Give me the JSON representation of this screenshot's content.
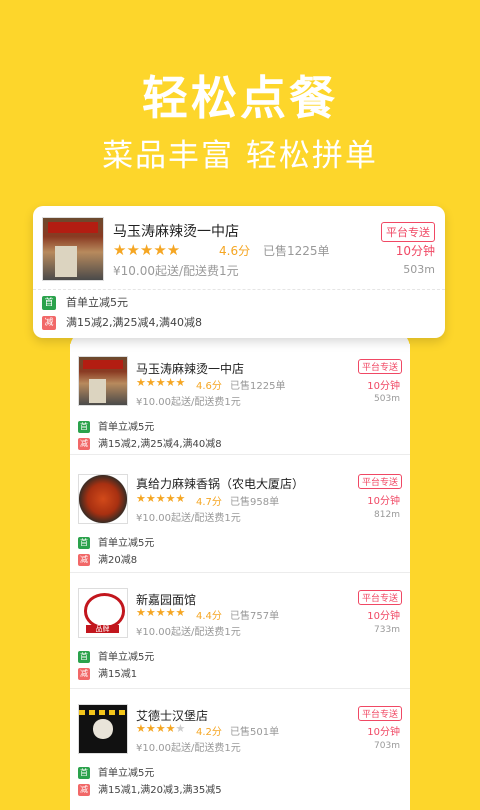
{
  "hero": {
    "title": "轻松点餐",
    "subtitle": "菜品丰富   轻松拼单"
  },
  "featured": {
    "name": "马玉涛麻辣烫一中店",
    "stars": "★★★★★",
    "rating": "4.6分",
    "sold": "已售1225单",
    "fee": "¥10.00起送/配送费1元",
    "tag": "平台专送",
    "time": "10分钟",
    "distance": "503m",
    "image_icon": "shop-storefront",
    "promos": [
      {
        "icon": "首",
        "text": "首单立减5元"
      },
      {
        "icon": "减",
        "text": "满15减2,满25减4,满40减8"
      }
    ]
  },
  "list": [
    {
      "name": "马玉涛麻辣烫一中店",
      "stars": "★★★★★",
      "rating": "4.6分",
      "sold": "已售1225单",
      "fee": "¥10.00起送/配送费1元",
      "tag": "平台专送",
      "time": "10分钟",
      "distance": "503m",
      "promos": [
        {
          "icon": "首",
          "text": "首单立减5元"
        },
        {
          "icon": "减",
          "text": "满15减2,满25减4,满40减8"
        }
      ]
    },
    {
      "name": "真给力麻辣香锅（农电大厦店）",
      "stars": "★★★★★",
      "rating": "4.7分",
      "sold": "已售958单",
      "fee": "¥10.00起送/配送费1元",
      "tag": "平台专送",
      "time": "10分钟",
      "distance": "812m",
      "promos": [
        {
          "icon": "首",
          "text": "首单立减5元"
        },
        {
          "icon": "减",
          "text": "满20减8"
        }
      ]
    },
    {
      "name": "新嘉园面馆",
      "stars": "★★★★★",
      "rating": "4.4分",
      "sold": "已售757单",
      "fee": "¥10.00起送/配送费1元",
      "tag": "平台专送",
      "time": "10分钟",
      "distance": "733m",
      "brand_label": "品牌",
      "promos": [
        {
          "icon": "首",
          "text": "首单立减5元"
        },
        {
          "icon": "减",
          "text": "满15减1"
        }
      ]
    },
    {
      "name": "艾德士汉堡店",
      "stars": "★★★★",
      "stars_empty": "★",
      "rating": "4.2分",
      "sold": "已售501单",
      "fee": "¥10.00起送/配送费1元",
      "tag": "平台专送",
      "time": "10分钟",
      "distance": "703m",
      "promos": [
        {
          "icon": "首",
          "text": "首单立减5元"
        },
        {
          "icon": "减",
          "text": "满15减1,满20减3,满35减5"
        }
      ]
    }
  ],
  "colors": {
    "background": "#FDD62B",
    "star": "#F5A623",
    "accent_red": "#F04864",
    "promo_green": "#2BA24C",
    "promo_red": "#F16868"
  }
}
